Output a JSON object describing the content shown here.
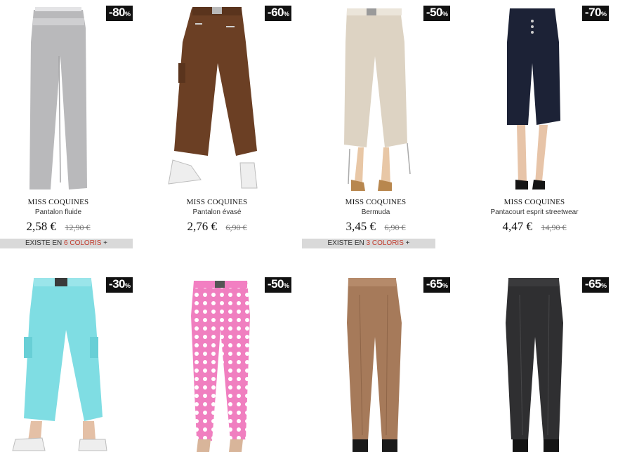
{
  "products": [
    {
      "discount": "-80",
      "percent": "%",
      "brand": "MISS COQUINES",
      "name": "Pantalon fluide",
      "price": "2,58 €",
      "old_price": "12,90 €",
      "colors_prefix": "EXISTE EN",
      "colors_count": "6 COLORIS",
      "colors_suffix": "+",
      "garment_color": "#b9b9bb",
      "garment_icon": "wide-trousers-icon"
    },
    {
      "discount": "-60",
      "percent": "%",
      "brand": "MISS COQUINES",
      "name": "Pantalon évasé",
      "price": "2,76 €",
      "old_price": "6,90 €",
      "garment_color": "#6b3f24",
      "garment_icon": "cargo-trousers-icon"
    },
    {
      "discount": "-50",
      "percent": "%",
      "brand": "MISS COQUINES",
      "name": "Bermuda",
      "price": "3,45 €",
      "old_price": "6,90 €",
      "colors_prefix": "EXISTE EN",
      "colors_count": "3 COLORIS",
      "colors_suffix": "+",
      "garment_color": "#ddd3c3",
      "garment_icon": "capri-pants-icon"
    },
    {
      "discount": "-70",
      "percent": "%",
      "brand": "MISS COQUINES",
      "name": "Pantacourt esprit streetwear",
      "price": "4,47 €",
      "old_price": "14,90 €",
      "garment_color": "#1c2236",
      "garment_icon": "cropped-trousers-icon"
    },
    {
      "discount": "-30",
      "percent": "%",
      "garment_color": "#7fdde3",
      "garment_icon": "cargo-capri-icon"
    },
    {
      "discount": "-50",
      "percent": "%",
      "garment_color": "#f07fc0",
      "garment_icon": "polka-dot-pants-icon"
    },
    {
      "discount": "-65",
      "percent": "%",
      "garment_color": "#a67a5a",
      "garment_icon": "leggings-icon"
    },
    {
      "discount": "-65",
      "percent": "%",
      "garment_color": "#2f2f31",
      "garment_icon": "leggings-icon"
    }
  ]
}
